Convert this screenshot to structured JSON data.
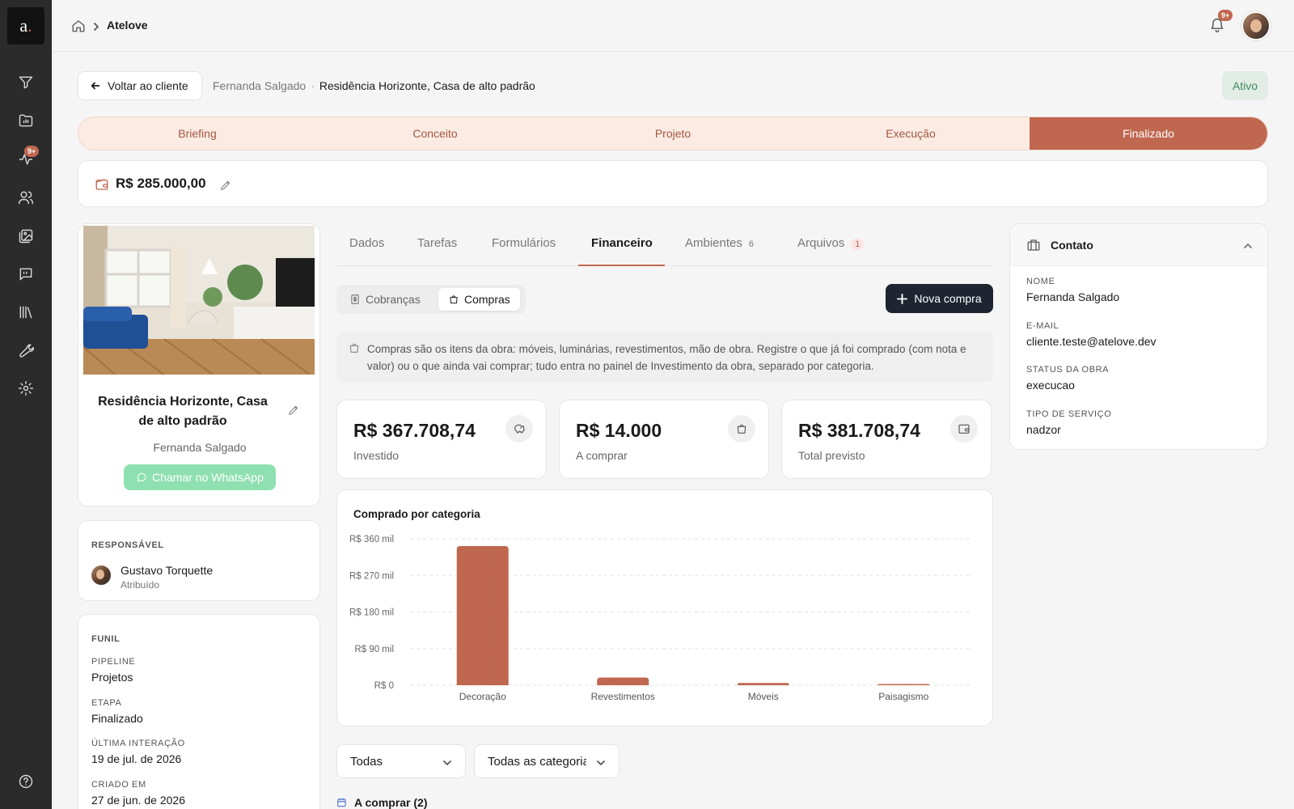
{
  "app": {
    "logo_letter": "a",
    "title": "Atelove",
    "notifications_badge": "9+",
    "sidebar_badge": "9+"
  },
  "colors": {
    "accent": "#c0674f",
    "sidebar_bg": "#2b2b2b",
    "stage_bg": "#fbebe3",
    "success_bg": "#e2ede6",
    "success_text": "#3e8a5c",
    "whatsapp": "#8fe0b0",
    "dark_button": "#1e2430"
  },
  "sidebar": {
    "items": [
      {
        "icon": "filter-icon"
      },
      {
        "icon": "folder-chart-icon"
      },
      {
        "icon": "activity-icon"
      },
      {
        "icon": "users-icon"
      },
      {
        "icon": "gallery-icon"
      },
      {
        "icon": "chat-icon"
      },
      {
        "icon": "library-icon"
      },
      {
        "icon": "wrench-icon"
      },
      {
        "icon": "gear-icon"
      },
      {
        "icon": "help-icon"
      }
    ]
  },
  "header": {
    "back_label": "Voltar ao cliente",
    "breadcrumb_client": "Fernanda Salgado",
    "breadcrumb_sep": "·",
    "breadcrumb_project": "Residência Horizonte, Casa de alto padrão",
    "status": "Ativo"
  },
  "stages": {
    "items": [
      "Briefing",
      "Conceito",
      "Projeto",
      "Execução",
      "Finalizado"
    ],
    "active": "Finalizado"
  },
  "budget": {
    "amount": "R$ 285.000,00"
  },
  "project": {
    "name": "Residência Horizonte, Casa de alto padrão",
    "client": "Fernanda Salgado",
    "whatsapp_label": "Chamar no WhatsApp"
  },
  "responsavel": {
    "label": "RESPONSÁVEL",
    "name": "Gustavo Torquette",
    "role": "Atribuído"
  },
  "funil": {
    "label": "FUNIL",
    "pipeline_label": "PIPELINE",
    "pipeline_value": "Projetos",
    "etapa_label": "ETAPA",
    "etapa_value": "Finalizado",
    "ultima_label": "ÚLTIMA INTERAÇÃO",
    "ultima_value": "19 de jul. de 2026",
    "criado_label": "CRIADO EM",
    "criado_value": "27 de jun. de 2026"
  },
  "tabs": {
    "dados": "Dados",
    "tarefas": "Tarefas",
    "formularios": "Formulários",
    "financeiro": "Financeiro",
    "ambientes": "Ambientes",
    "ambientes_count": "6",
    "arquivos": "Arquivos",
    "arquivos_count": "1",
    "active": "Financeiro"
  },
  "subtabs": {
    "cobrancas": "Cobranças",
    "compras": "Compras",
    "active": "Compras"
  },
  "nova_compra_label": "Nova compra",
  "info_text": "Compras são os itens da obra: móveis, luminárias, revestimentos, mão de obra. Registre o que já foi comprado (com nota e valor) ou o que ainda vai comprar; tudo entra no painel de Investimento da obra, separado por categoria.",
  "stats": [
    {
      "value": "R$ 367.708,74",
      "label": "Investido",
      "icon": "piggy-bank-icon"
    },
    {
      "value": "R$ 14.000",
      "label": "A comprar",
      "icon": "shopping-bag-icon"
    },
    {
      "value": "R$ 381.708,74",
      "label": "Total previsto",
      "icon": "wallet-icon"
    }
  ],
  "chart_data": {
    "type": "bar",
    "title": "Comprado por categoria",
    "categories": [
      "Decoração",
      "Revestimentos",
      "Móveis",
      "Paisagismo"
    ],
    "values": [
      342000,
      19000,
      5500,
      1200
    ],
    "ylim": [
      0,
      360000
    ],
    "yticks": [
      0,
      90000,
      180000,
      270000,
      360000
    ],
    "ytick_labels": [
      "R$ 0",
      "R$ 90 mil",
      "R$ 180 mil",
      "R$ 270 mil",
      "R$ 360 mil"
    ],
    "grid": true,
    "legend": "none",
    "color": "#c0674f"
  },
  "filters": {
    "status_value": "Todas",
    "category_value": "Todas as categorias"
  },
  "list_header": "A comprar (2)",
  "contact": {
    "title": "Contato",
    "nome_label": "NOME",
    "nome_value": "Fernanda Salgado",
    "email_label": "E-MAIL",
    "email_value": "cliente.teste@atelove.dev",
    "status_label": "STATUS DA OBRA",
    "status_value": "execucao",
    "tipo_label": "TIPO DE SERVIÇO",
    "tipo_value": "nadzor"
  }
}
